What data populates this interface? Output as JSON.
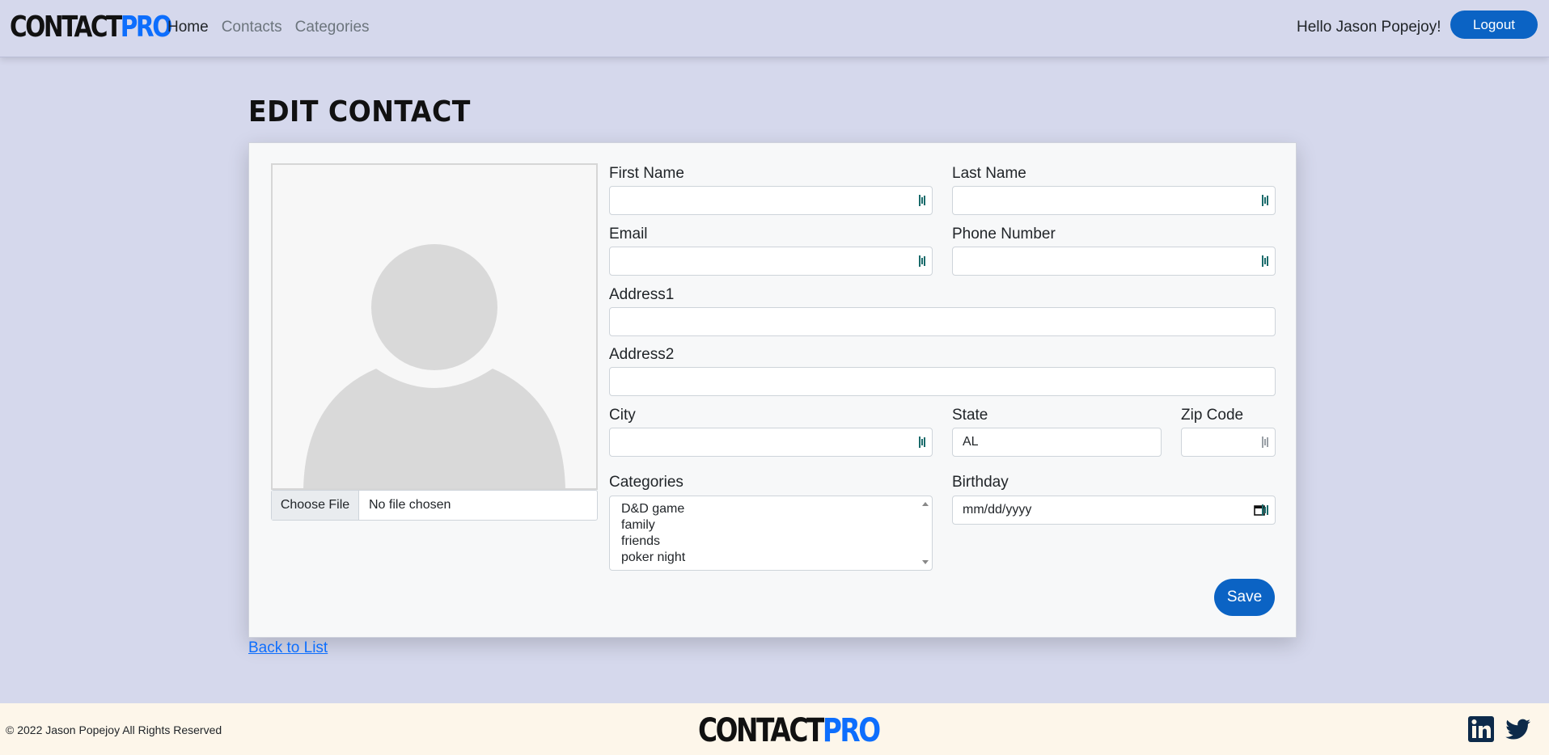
{
  "nav": {
    "brand_part1": "CONTACT",
    "brand_part2": "PRO",
    "links": [
      "Home",
      "Contacts",
      "Categories"
    ],
    "greeting": "Hello Jason Popejoy!",
    "logout_label": "Logout"
  },
  "page": {
    "title": "EDIT CONTACT"
  },
  "form": {
    "choose_file_label": "Choose File",
    "file_status": "No file chosen",
    "first_name": {
      "label": "First Name",
      "value": ""
    },
    "last_name": {
      "label": "Last Name",
      "value": ""
    },
    "email": {
      "label": "Email",
      "value": ""
    },
    "phone": {
      "label": "Phone Number",
      "value": ""
    },
    "address1": {
      "label": "Address1",
      "value": ""
    },
    "address2": {
      "label": "Address2",
      "value": ""
    },
    "city": {
      "label": "City",
      "value": ""
    },
    "state": {
      "label": "State",
      "value": "AL"
    },
    "zip": {
      "label": "Zip Code",
      "value": ""
    },
    "categories": {
      "label": "Categories",
      "options": [
        "D&D game",
        "family",
        "friends",
        "poker night"
      ]
    },
    "birthday": {
      "label": "Birthday",
      "placeholder": "mm/dd/yyyy"
    },
    "save_label": "Save"
  },
  "back_link": "Back to List",
  "footer": {
    "copyright": "© 2022 Jason Popejoy All Rights Reserved",
    "brand_part1": "CONTACT",
    "brand_part2": "PRO",
    "social_icons": [
      "linkedin-icon",
      "twitter-icon"
    ]
  },
  "colors": {
    "background": "#d5d8ec",
    "accent": "#0b63c4",
    "footer_bg": "#fdf6ea"
  }
}
